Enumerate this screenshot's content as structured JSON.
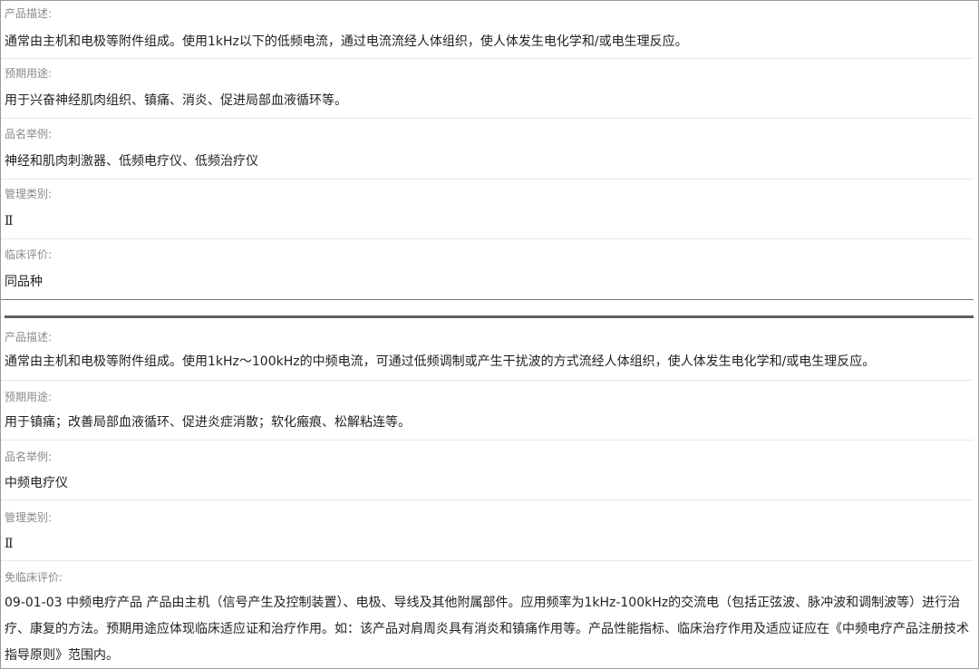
{
  "section1": {
    "description_label": "产品描述:",
    "description_value": "通常由主机和电极等附件组成。使用1kHz以下的低频电流，通过电流流经人体组织，使人体发生电化学和/或电生理反应。",
    "intended_use_label": "预期用途:",
    "intended_use_value": "用于兴奋神经肌肉组织、镇痛、消炎、促进局部血液循环等。",
    "examples_label": "品名举例:",
    "examples_value": "神经和肌肉刺激器、低频电疗仪、低频治疗仪",
    "class_label": "管理类别:",
    "class_value": "Ⅱ",
    "clinical_label": "临床评价:",
    "clinical_value": "同品种"
  },
  "section2": {
    "description_label": "产品描述:",
    "description_value": "通常由主机和电极等附件组成。使用1kHz～100kHz的中频电流，可通过低频调制或产生干扰波的方式流经人体组织，使人体发生电化学和/或电生理反应。",
    "intended_use_label": "预期用途:",
    "intended_use_value": "用于镇痛；改善局部血液循环、促进炎症消散；软化瘢痕、松解粘连等。",
    "examples_label": "品名举例:",
    "examples_value": "中频电疗仪",
    "class_label": "管理类别:",
    "class_value": "Ⅱ",
    "clinical_label": "免临床评价:",
    "clinical_value": "09-01-03 中频电疗产品 产品由主机（信号产生及控制装置）、电极、导线及其他附属部件。应用频率为1kHz-100kHz的交流电（包括正弦波、脉冲波和调制波等）进行治疗、康复的方法。预期用途应体现临床适应证和治疗作用。如：该产品对肩周炎具有消炎和镇痛作用等。产品性能指标、临床治疗作用及适应证应在《中频电疗产品注册技术指导原则》范围内。"
  }
}
